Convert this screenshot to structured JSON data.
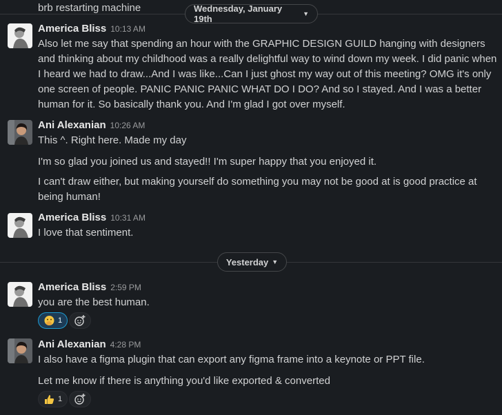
{
  "top_partial_text": "brb restarting machine",
  "dividers": {
    "wed": "Wednesday, January 19th",
    "yest": "Yesterday"
  },
  "messages": [
    {
      "author": "America Bliss",
      "time": "10:13 AM",
      "lines": [
        "Also let me say that spending an hour with the GRAPHIC DESIGN GUILD hanging with designers and thinking about my childhood was a really delightful way to wind down my week. I did panic when I heard we had to draw...And I was like...Can I just ghost my way out of this meeting? OMG it's only one screen of people. PANIC PANIC PANIC WHAT DO I DO? And so I stayed. And I was a better human for it. So basically thank you. And I'm glad I got over myself."
      ]
    },
    {
      "author": "Ani Alexanian",
      "time": "10:26 AM",
      "lines": [
        "This ^. Right here. Made my day",
        "I'm so glad you joined us and stayed!! I'm super happy that you enjoyed it.",
        "I can't draw either, but making yourself do something you may not be good at is good practice at being human!"
      ]
    },
    {
      "author": "America Bliss",
      "time": "10:31 AM",
      "lines": [
        "I love that sentiment."
      ]
    },
    {
      "author": "America Bliss",
      "time": "2:59 PM",
      "lines": [
        "you are the best human."
      ],
      "reaction": {
        "emoji": "face-with-hand-over-mouth",
        "count": "1"
      }
    },
    {
      "author": "Ani Alexanian",
      "time": "4:28 PM",
      "lines": [
        "I also have a figma plugin that can export any figma frame into a keynote or PPT file.",
        "Let me know if there is anything you'd like exported & converted"
      ],
      "reaction": {
        "emoji": "thumbs-up",
        "count": "1"
      }
    }
  ],
  "colors": {
    "background": "#1a1d21",
    "reaction_active_bg": "#1d3b55",
    "reaction_active_border": "#1d9bd1"
  }
}
